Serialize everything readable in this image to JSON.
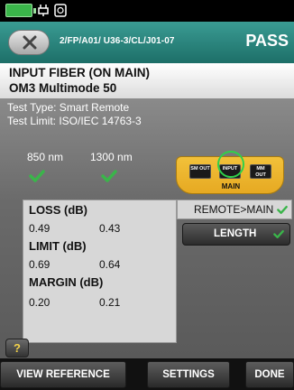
{
  "status_bar": {
    "icons": [
      "battery-icon",
      "plug-icon",
      "adapter-icon"
    ]
  },
  "header": {
    "back_icon": "close-x-icon",
    "fiber_id": "2/FP/A01/ U36-3/CL/J01-07",
    "result": "PASS"
  },
  "title": {
    "line1": "INPUT FIBER (ON MAIN)",
    "line2": "OM3 Multimode 50"
  },
  "test_info": {
    "type": "Test Type: Smart Remote",
    "limit": "Test Limit: ISO/IEC 14763-3"
  },
  "wavelengths": [
    {
      "label": "850 nm",
      "status": "check-icon"
    },
    {
      "label": "1300 nm",
      "status": "check-icon"
    }
  ],
  "ports": {
    "sm": "SM OUT",
    "input": "INPUT",
    "mm": "MM OUT",
    "label": "MAIN"
  },
  "results": {
    "loss_label": "LOSS (dB)",
    "loss": [
      "0.49",
      "0.43"
    ],
    "limit_label": "LIMIT (dB)",
    "limit": [
      "0.69",
      "0.64"
    ],
    "margin_label": "MARGIN (dB)",
    "margin": [
      "0.20",
      "0.21"
    ]
  },
  "direction": {
    "label": "REMOTE>MAIN"
  },
  "length_button": {
    "label": "LENGTH"
  },
  "help_button": {
    "label": "?"
  },
  "footer": {
    "view_reference": "VIEW REFERENCE",
    "settings": "SETTINGS",
    "done": "DONE"
  },
  "colors": {
    "header": "#2a8a82",
    "check": "#3ab54a",
    "port": "#f2c13a",
    "help": "#f3d24a"
  }
}
